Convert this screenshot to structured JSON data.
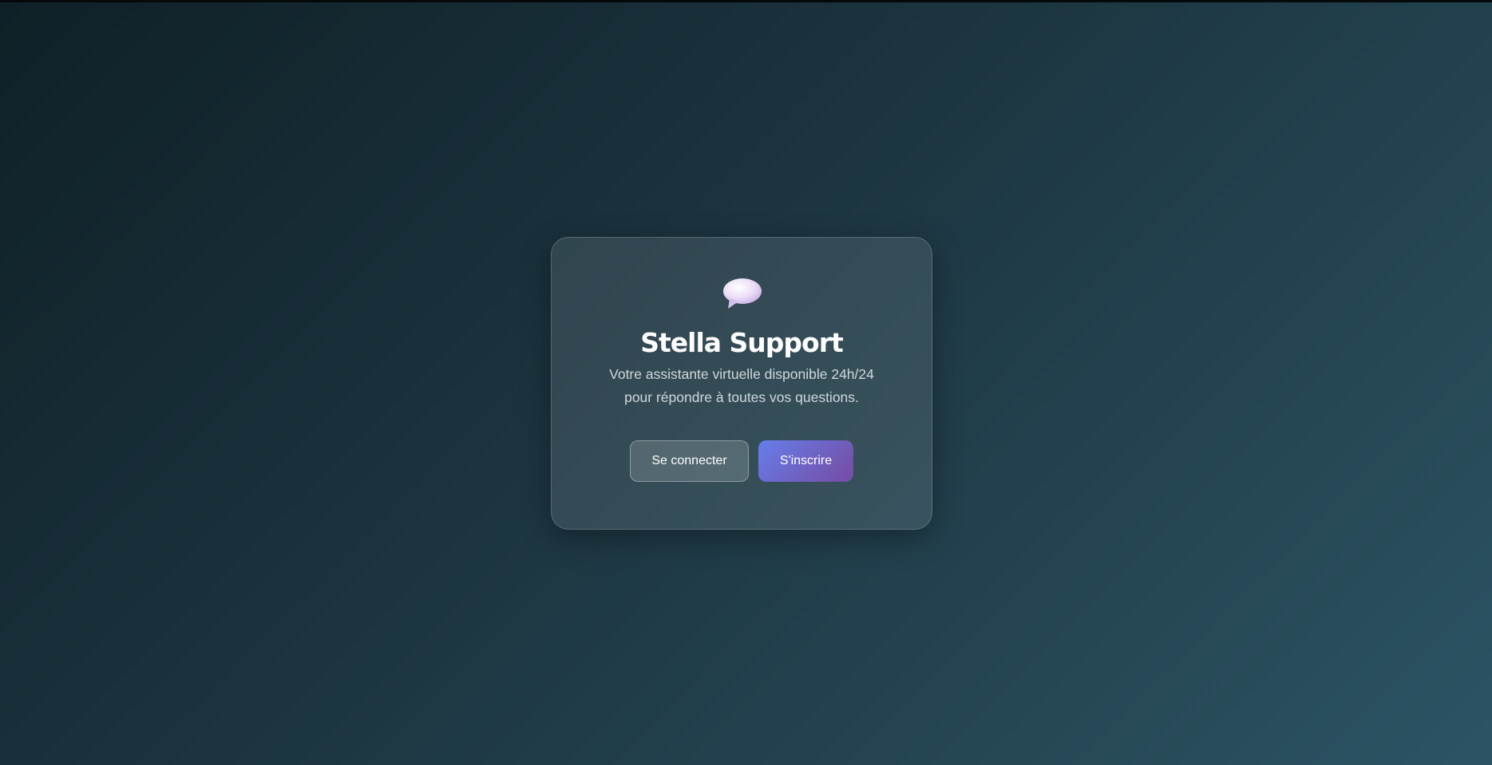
{
  "card": {
    "logo_icon": "speech-bubble-icon",
    "title": "Stella Support",
    "subtitle_line1": "Votre assistante virtuelle disponible 24h/24",
    "subtitle_line2": "pour répondre à toutes vos questions."
  },
  "actions": {
    "login_label": "Se connecter",
    "signup_label": "S'inscrire"
  },
  "colors": {
    "background_start": "#0f2027",
    "background_end": "#2c5364",
    "accent_start": "#667eea",
    "accent_end": "#764ba2"
  }
}
